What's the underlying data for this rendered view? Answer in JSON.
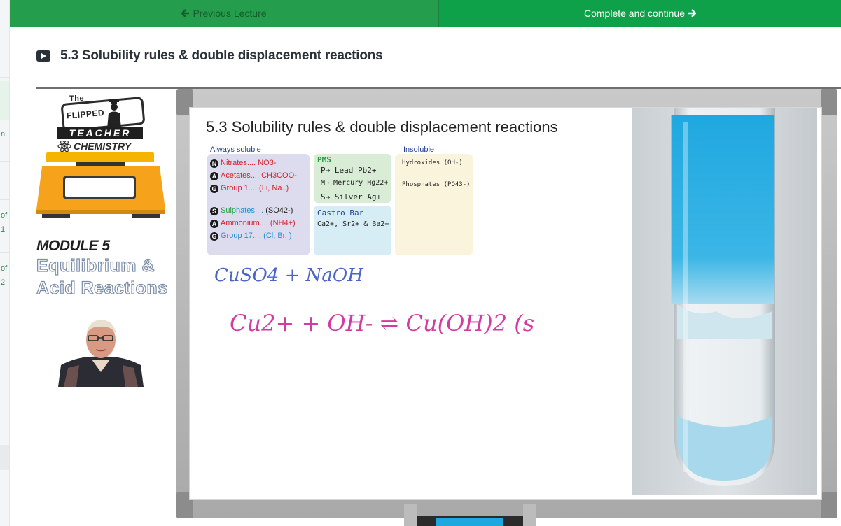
{
  "nav": {
    "previous_label": "Previous Lecture",
    "complete_label": "Complete and continue"
  },
  "sidebar": {
    "fragments": [
      "n.",
      "of",
      "1",
      "of",
      "2"
    ]
  },
  "lecture": {
    "title": "5.3 Solubility rules & double displacement reactions"
  },
  "brand": {
    "the": "The",
    "flipped": "FLIPPED",
    "teacher": "TEACHER",
    "chemistry": "CHEMISTRY",
    "module": "MODULE 5",
    "topic_line1": "Equilibrium &",
    "topic_line2": "Acid Reactions"
  },
  "slide": {
    "title": "5.3 Solubility rules & double displacement reactions",
    "always_soluble_header": "Always soluble",
    "insoluble_header": "Insoluble",
    "soluble_group1": [
      {
        "letter": "N",
        "name": "Nitrates....",
        "formula": "NO3-"
      },
      {
        "letter": "A",
        "name": "Acetates....",
        "formula": "CH3COO-"
      },
      {
        "letter": "G",
        "name": "Group 1....",
        "formula": "(Li, Na..)"
      }
    ],
    "soluble_group2": [
      {
        "letter": "S",
        "name_a": "Sulp",
        "name_b": "hates....",
        "formula": "(SO42-)"
      },
      {
        "letter": "A",
        "name": "Ammonium....",
        "formula": "(NH4+)"
      },
      {
        "letter": "G",
        "name": "Group 17....",
        "formula": "(Cl, Br, )"
      }
    ],
    "pms_header": "PMS",
    "pms_items": [
      "P→ Lead Pb2+",
      "M→ Mercury Hg22+",
      "S→ Silver Ag+"
    ],
    "castro_header": "Castro Bar",
    "castro_items": "Ca2+, Sr2+ & Ba2+",
    "insoluble_items": [
      "Hydroxides (OH-)",
      "Phosphates (PO43-)"
    ],
    "handwriting_line1": "CuSO4 + NaOH",
    "handwriting_line2": "Cu2+ + OH- ⇌ Cu(OH)2 (s"
  },
  "colors": {
    "nav_prev": "#249d4c",
    "nav_next": "#0ea14a",
    "ink_blue": "#4a64c8",
    "ink_pink": "#d43aa1",
    "precipitate_blue": "#1fa8e0"
  },
  "icons": {
    "previous": "arrow-left-icon",
    "next": "arrow-right-icon",
    "lecture": "video-icon"
  }
}
